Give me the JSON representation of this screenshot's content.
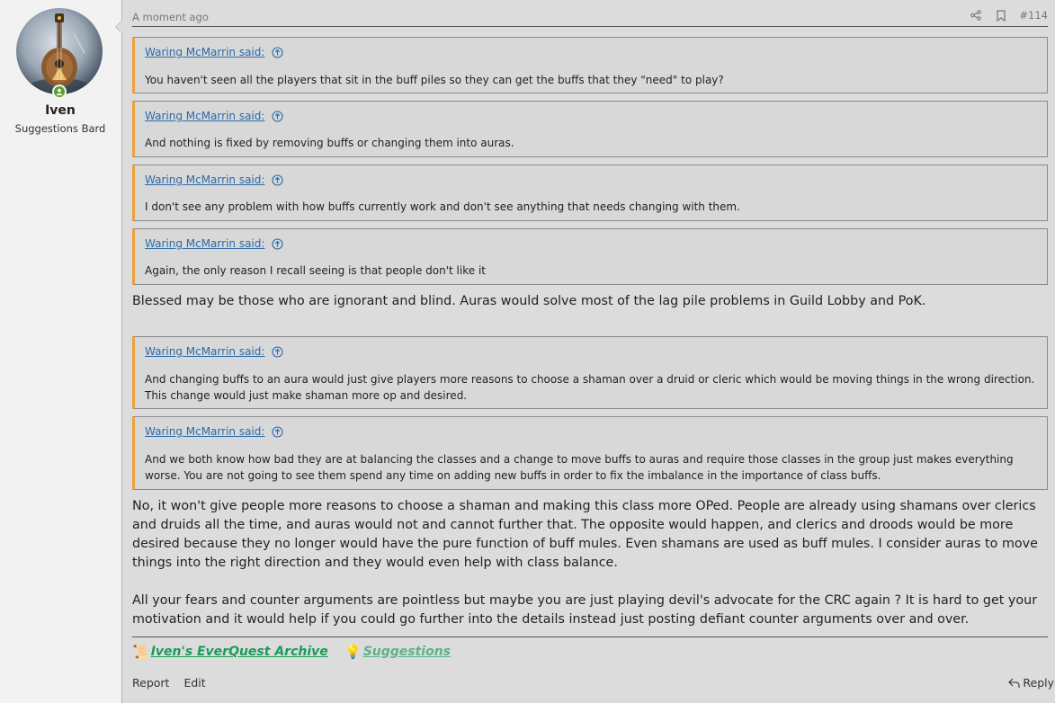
{
  "user": {
    "name": "Iven",
    "title": "Suggestions Bard",
    "status_color": "#5aa02c"
  },
  "post": {
    "timestamp": "A moment ago",
    "number": "#114",
    "icons": [
      "share-icon",
      "bookmark-icon"
    ]
  },
  "quotes": [
    {
      "author": "Waring McMarrin said:",
      "text": "You haven't seen all the players that sit in the buff piles so they can get the buffs that they \"need\" to play?"
    },
    {
      "author": "Waring McMarrin said:",
      "text": "And nothing is fixed by removing buffs or changing them into auras."
    },
    {
      "author": "Waring McMarrin said:",
      "text": "I don't see any problem with how buffs currently work and don't see anything that needs changing with them."
    },
    {
      "author": "Waring McMarrin said:",
      "text": "Again, the only reason I recall seeing is that people don't like it"
    },
    {
      "author": "Waring McMarrin said:",
      "text": "And changing buffs to an aura would just give players more reasons to choose a shaman over a druid or cleric which would be moving things in the wrong direction. This change would just make shaman more op and desired."
    },
    {
      "author": "Waring McMarrin said:",
      "text": "And we both know how bad they are at balancing the classes and a change to move buffs to auras and require those classes in the group just makes everything worse. You are not going to see them spend any time on adding new buffs in order to fix the imbalance in the importance of class buffs."
    }
  ],
  "paragraphs": [
    "Blessed may be those who are ignorant and blind. Auras would solve most of the lag pile problems in Guild Lobby and PoK.",
    "No, it won't give people more reasons to choose a shaman and making this class more OPed. People are already using shamans over clerics and druids all the time, and auras would not and cannot further that. The opposite would happen, and clerics and droods would be more desired because they no longer would have the pure function of buff mules. Even shamans are used as buff mules. I consider auras to move things into the right direction and they would even help with class balance.",
    "All your fears and counter arguments are pointless but maybe you are just playing devil's advocate for the CRC again ? It is hard to get your motivation and it would help if you could go further into the details instead just posting defiant counter arguments over and over."
  ],
  "signature": {
    "link1_emoji": "📜",
    "link1": "Iven's EverQuest Archive",
    "link2_emoji": "💡",
    "link2": "Suggestions"
  },
  "actions": {
    "report": "Report",
    "edit": "Edit",
    "reply": "Reply"
  },
  "colors": {
    "quote_border": "#f0a03a",
    "link": "#2b6aa8",
    "sig_link": "#1a9c5a"
  }
}
